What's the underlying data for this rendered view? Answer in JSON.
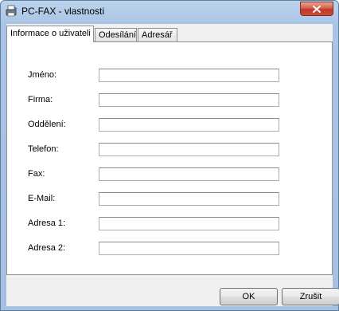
{
  "window": {
    "title": "PC-FAX - vlastnosti"
  },
  "tabs": [
    {
      "label": "Informace o uživateli"
    },
    {
      "label": "Odesílání"
    },
    {
      "label": "Adresář"
    }
  ],
  "form": {
    "fields": [
      {
        "label": "Jméno:",
        "value": ""
      },
      {
        "label": "Firma:",
        "value": ""
      },
      {
        "label": "Oddělení:",
        "value": ""
      },
      {
        "label": "Telefon:",
        "value": ""
      },
      {
        "label": "Fax:",
        "value": ""
      },
      {
        "label": "E-Mail:",
        "value": ""
      },
      {
        "label": "Adresa 1:",
        "value": ""
      },
      {
        "label": "Adresa 2:",
        "value": ""
      }
    ]
  },
  "buttons": {
    "ok": "OK",
    "cancel": "Zrušit"
  },
  "icons": {
    "app": "fax-printer-icon",
    "close": "close-icon"
  },
  "colors": {
    "close_button": "#c0392b",
    "titlebar": "#a9c4e4"
  }
}
